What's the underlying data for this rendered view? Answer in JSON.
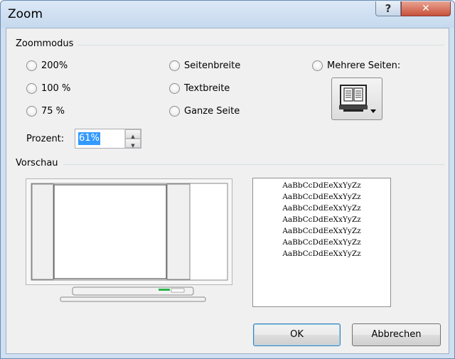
{
  "window": {
    "title": "Zoom"
  },
  "titlebar": {
    "help_glyph": "?",
    "close_glyph": "✕"
  },
  "zoom_mode": {
    "group_label": "Zoommodus",
    "options": [
      {
        "label": "200%",
        "selected": false
      },
      {
        "label": "100 %",
        "selected": false
      },
      {
        "label": "75 %",
        "selected": false
      },
      {
        "label": "Seitenbreite",
        "selected": false
      },
      {
        "label": "Textbreite",
        "selected": false
      },
      {
        "label": "Ganze Seite",
        "selected": false
      },
      {
        "label": "Mehrere Seiten:",
        "selected": false
      }
    ],
    "percent_label": "Prozent:",
    "percent_value": "61%",
    "multi_pages_icon": "monitor-pages-dropdown-icon"
  },
  "preview": {
    "group_label": "Vorschau",
    "sample_lines": [
      "AaBbCcDdEeXxYyZz",
      "AaBbCcDdEeXxYyZz",
      "AaBbCcDdEeXxYyZz",
      "AaBbCcDdEeXxYyZz",
      "AaBbCcDdEeXxYyZz",
      "AaBbCcDdEeXxYyZz",
      "AaBbCcDdEeXxYyZz"
    ]
  },
  "buttons": {
    "ok": "OK",
    "cancel": "Abbrechen"
  },
  "colors": {
    "selection": "#3399ff",
    "accent_green": "#2bb34a"
  }
}
